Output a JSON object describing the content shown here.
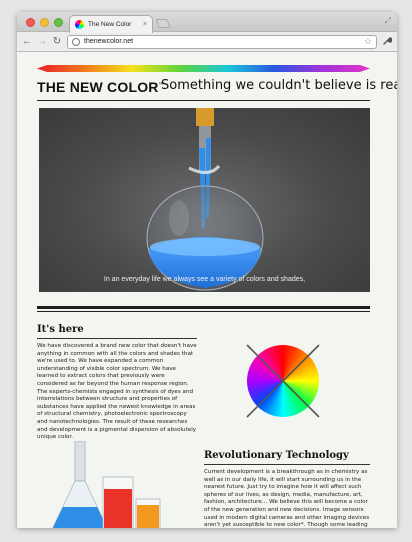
{
  "browser": {
    "tab_title": "The New Color",
    "tab_close": "×",
    "url": "thenewcolor.net",
    "back_glyph": "←",
    "forward_glyph": "→",
    "reload_glyph": "↻",
    "star_glyph": "☆",
    "wrench_glyph": "🔧",
    "resize_glyph": "⤢"
  },
  "header": {
    "brand": "THE NEW COLOR",
    "trademark": "™",
    "tagline": "Something we couldn't believe is real"
  },
  "video": {
    "caption": "In an everyday life we always see a variety of colors and shades,"
  },
  "section_here": {
    "title": "It's here",
    "paragraphs": [
      "We have discovered a brand new color that doesn't have anything in common with all the colors and shades that we're used to. We have expanded a common understanding of visible color spectrum. We have learned to extract colors that previously were considered as far beyond the human response region.",
      "The experts-chemists engaged in synthesis of dyes and interrelations between structure and properties of substances have applied the newest knowledge in areas of structural chemistry, photoelectronic spectroscopy and nanotechnologies. The result of these researches and development is a pigmental dispersion of absolutely unique color."
    ]
  },
  "section_tech": {
    "title": "Revolutionary Technology",
    "paragraphs": [
      "Current development is a breakthrough as in chemistry as well as in our daily life, it will start surrounding us in the nearest future. Just try to imagine how it will affect such spheres of our lives, as design, media, manufacture, art, fashion, architecture… We believe this will become a color of the new generation and new decisions. Image sensors used in modern digital cameras and other imaging devices aren't yet susceptible to new color*. Though some leading companies, hardware vendors have already shown their"
    ]
  },
  "icons": {
    "wheel": "color-wheel-crossed-icon",
    "flask": "round-flask-illustration"
  },
  "colors": {
    "page_bg": "#f3f5f1",
    "text": "#111111",
    "liquid_blue": "#2f8fe8",
    "liquid_red": "#e8322a",
    "liquid_orange": "#f39a1e"
  }
}
